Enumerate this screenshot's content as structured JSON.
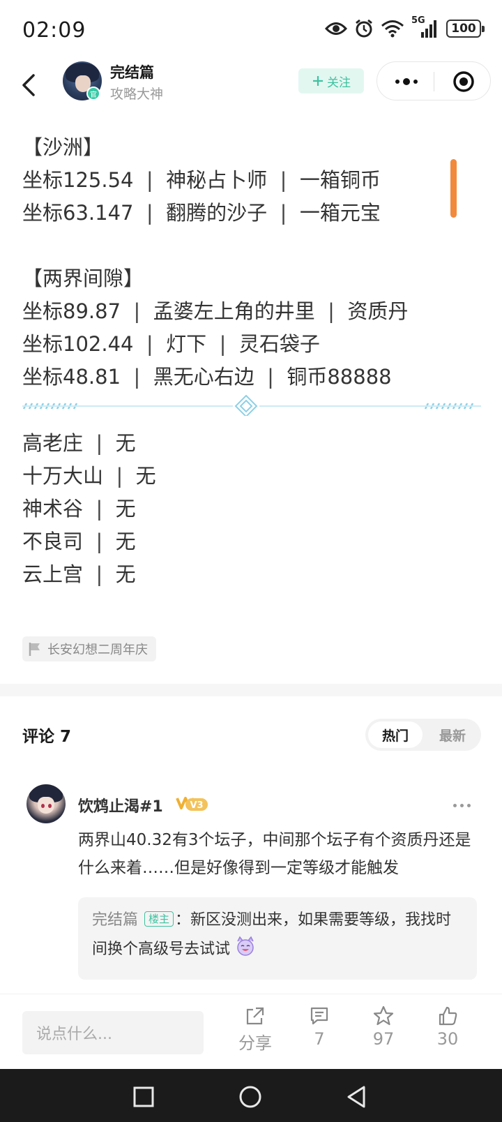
{
  "status_bar": {
    "time": "02:09",
    "network": "5G",
    "battery": "100"
  },
  "header": {
    "author_name": "完结篇",
    "author_title": "攻略大神",
    "follow_label": "关注",
    "avatar_badge": "官"
  },
  "content": {
    "section1_title": "【沙洲】",
    "section1_items": [
      {
        "coord": "坐标125.54",
        "location": "神秘占卜师",
        "reward": "一箱铜币"
      },
      {
        "coord": "坐标63.147",
        "location": "翻腾的沙子",
        "reward": "一箱元宝"
      }
    ],
    "section2_title": "【两界间隙】",
    "section2_items": [
      {
        "coord": "坐标89.87",
        "location": "孟婆左上角的井里",
        "reward": "资质丹"
      },
      {
        "coord": "坐标102.44",
        "location": "灯下",
        "reward": "灵石袋子"
      },
      {
        "coord": "坐标48.81",
        "location": "黑无心右边",
        "reward": "铜币88888"
      }
    ],
    "separator": "|",
    "none_list": [
      {
        "place": "高老庄",
        "value": "无"
      },
      {
        "place": "十万大山",
        "value": "无"
      },
      {
        "place": "神术谷",
        "value": "无"
      },
      {
        "place": "不良司",
        "value": "无"
      },
      {
        "place": "云上宫",
        "value": "无"
      }
    ],
    "topic_tag": "长安幻想二周年庆"
  },
  "comments": {
    "title": "评论 7",
    "sort_hot": "热门",
    "sort_new": "最新",
    "items": [
      {
        "user": "饮鸩止渴#1",
        "level": "V3",
        "text": "两界山40.32有3个坛子，中间那个坛子有个资质丹还是什么来着……但是好像得到一定等级才能触发",
        "reply_author": "完结篇",
        "reply_tag": "楼主",
        "reply_text": "：新区没测出来，如果需要等级，我找时间换个高级号去试试"
      }
    ]
  },
  "bottom_bar": {
    "input_placeholder": "说点什么...",
    "share_label": "分享",
    "comment_count": "7",
    "favorite_count": "97",
    "like_count": "30"
  },
  "colors": {
    "accent_green": "#3fc2a0",
    "scroll_orange": "#f28a3c",
    "divider_blue": "#8fd0e6"
  }
}
